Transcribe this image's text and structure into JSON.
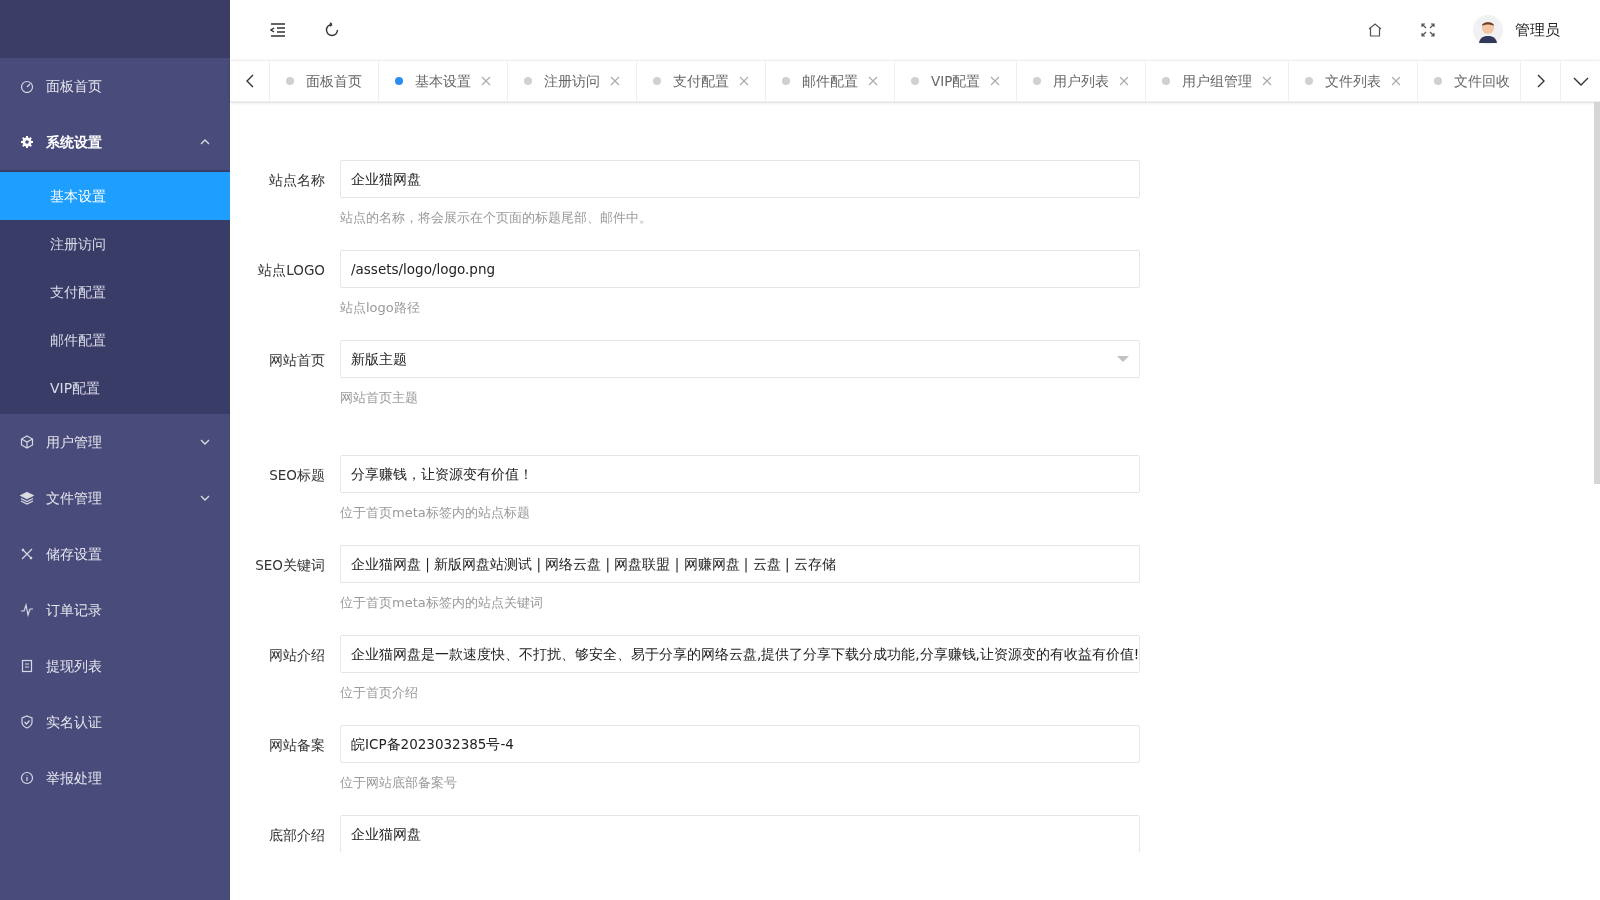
{
  "sidebar": {
    "items": [
      {
        "label": "面板首页",
        "selected": false
      },
      {
        "label": "系统设置",
        "selected": false,
        "expanded": true,
        "children": [
          {
            "label": "基本设置",
            "selected": true
          },
          {
            "label": "注册访问",
            "selected": false
          },
          {
            "label": "支付配置",
            "selected": false
          },
          {
            "label": "邮件配置",
            "selected": false
          },
          {
            "label": "VIP配置",
            "selected": false
          }
        ]
      },
      {
        "label": "用户管理",
        "selected": false,
        "expanded": false
      },
      {
        "label": "文件管理",
        "selected": false,
        "expanded": false
      },
      {
        "label": "储存设置",
        "selected": false
      },
      {
        "label": "订单记录",
        "selected": false
      },
      {
        "label": "提现列表",
        "selected": false
      },
      {
        "label": "实名认证",
        "selected": false
      },
      {
        "label": "举报处理",
        "selected": false
      }
    ]
  },
  "header": {
    "user": "管理员"
  },
  "tabs": [
    {
      "label": "面板首页",
      "selected": false,
      "closable": false
    },
    {
      "label": "基本设置",
      "selected": true,
      "closable": true
    },
    {
      "label": "注册访问",
      "selected": false,
      "closable": true
    },
    {
      "label": "支付配置",
      "selected": false,
      "closable": true
    },
    {
      "label": "邮件配置",
      "selected": false,
      "closable": true
    },
    {
      "label": "VIP配置",
      "selected": false,
      "closable": true
    },
    {
      "label": "用户列表",
      "selected": false,
      "closable": true
    },
    {
      "label": "用户组管理",
      "selected": false,
      "closable": true
    },
    {
      "label": "文件列表",
      "selected": false,
      "closable": true
    },
    {
      "label": "文件回收",
      "selected": false,
      "closable": false
    }
  ],
  "form": {
    "fields": [
      {
        "label": "站点名称",
        "kind": "input",
        "value": "企业猫网盘",
        "help": "站点的名称，将会展示在个页面的标题尾部、邮件中。"
      },
      {
        "label": "站点LOGO",
        "kind": "input",
        "value": "/assets/logo/logo.png",
        "help": "站点logo路径"
      },
      {
        "label": "网站首页",
        "kind": "select",
        "value": "新版主题",
        "help": "网站首页主题"
      },
      {
        "label": "SEO标题",
        "kind": "input",
        "value": "分享赚钱，让资源变有价值！",
        "help": "位于首页meta标签内的站点标题"
      },
      {
        "label": "SEO关键词",
        "kind": "input",
        "value": "企业猫网盘 | 新版网盘站测试 | 网络云盘 | 网盘联盟 | 网赚网盘 | 云盘 | 云存储",
        "help": "位于首页meta标签内的站点关键词"
      },
      {
        "label": "网站介绍",
        "kind": "input",
        "value": "企业猫网盘是一款速度快、不打扰、够安全、易于分享的网络云盘,提供了分享下载分成功能,分享赚钱,让资源变的有收益有价值!",
        "help": "位于首页介绍"
      },
      {
        "label": "网站备案",
        "kind": "input",
        "value": "皖ICP备2023032385号-4",
        "help": "位于网站底部备案号"
      },
      {
        "label": "底部介绍",
        "kind": "input",
        "value": "企业猫网盘"
      }
    ]
  }
}
